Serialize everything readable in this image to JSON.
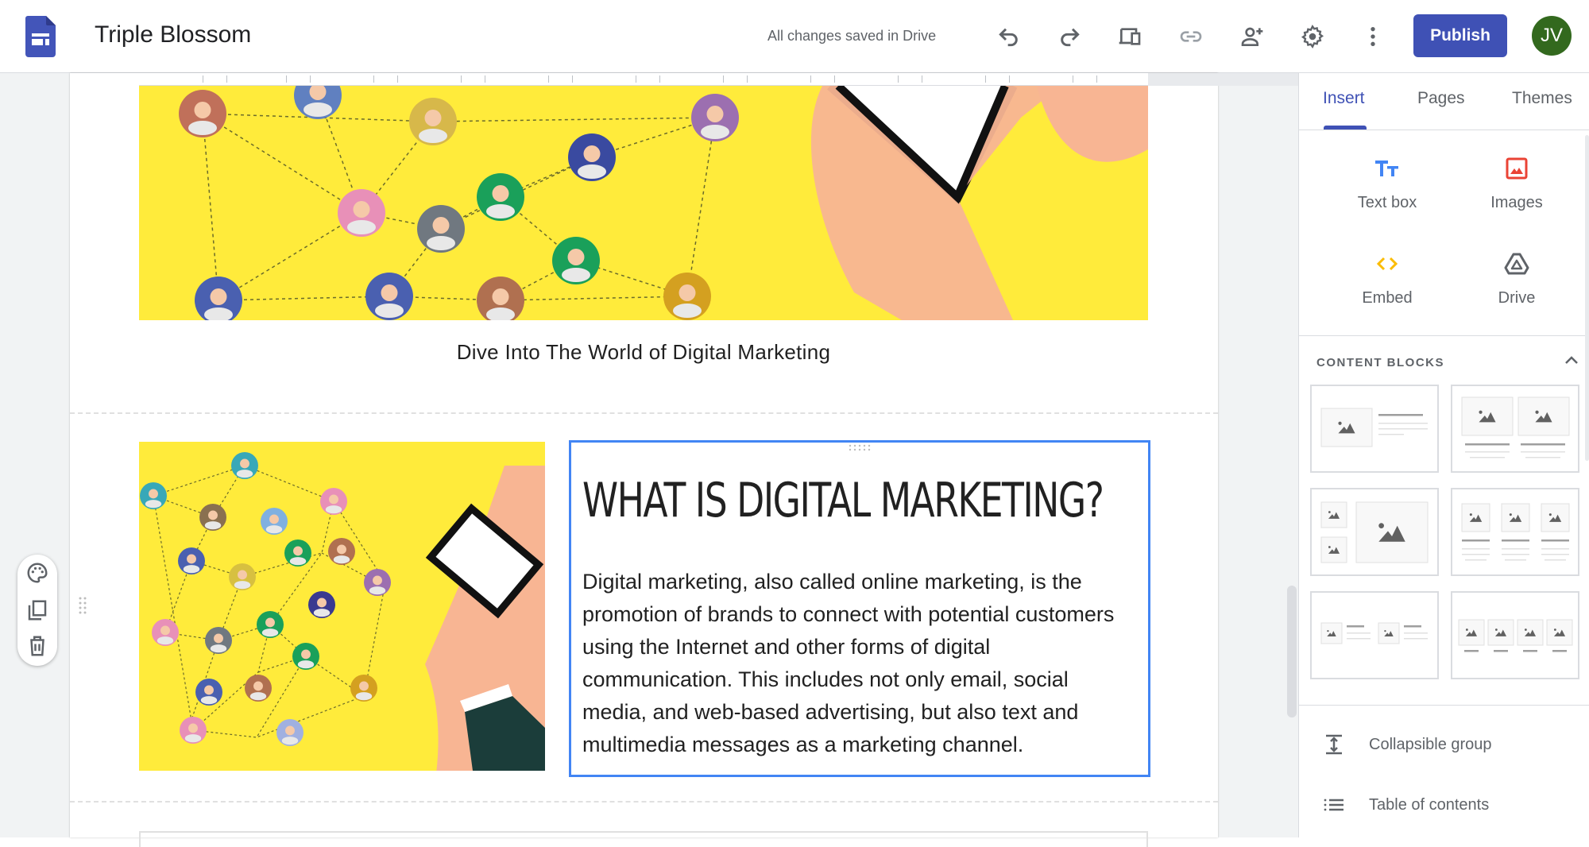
{
  "header": {
    "app_icon": "google-sites-icon",
    "title": "Triple Blossom",
    "save_status": "All changes saved in Drive",
    "toolbar_icons": [
      "undo-icon",
      "redo-icon",
      "preview-devices-icon",
      "copy-link-icon",
      "share-add-person-icon",
      "settings-gear-icon",
      "more-vert-icon"
    ],
    "publish_label": "Publish",
    "avatar_initials": "JV"
  },
  "canvas": {
    "banner_caption": "Dive Into The World of Digital Marketing",
    "section": {
      "heading": "WHAT IS DIGITAL MARKETING?",
      "body": "Digital marketing, also called online marketing, is the promotion of brands to connect with potential customers using the Internet and other forms of digital communication. This includes not only email, social media, and web-based advertising, but also text and multimedia messages as a marketing channel."
    },
    "section_tools": [
      "palette-icon",
      "duplicate-icon",
      "delete-icon"
    ]
  },
  "panel": {
    "tabs": [
      {
        "label": "Insert",
        "active": true
      },
      {
        "label": "Pages",
        "active": false
      },
      {
        "label": "Themes",
        "active": false
      }
    ],
    "insert_items": [
      {
        "label": "Text box",
        "icon": "text-box-icon",
        "color": "#4285f4"
      },
      {
        "label": "Images",
        "icon": "image-icon",
        "color": "#ea4335"
      },
      {
        "label": "Embed",
        "icon": "embed-code-icon",
        "color": "#fbbc04"
      },
      {
        "label": "Drive",
        "icon": "drive-icon",
        "color": "#5f6368"
      }
    ],
    "content_blocks_title": "CONTENT BLOCKS",
    "content_blocks": [
      "image-left-text-right",
      "two-images-with-text",
      "image-collage",
      "three-images-with-text",
      "two-images-side-text",
      "four-images-captions"
    ],
    "list_items": [
      {
        "label": "Collapsible group",
        "icon": "collapsible-group-icon"
      },
      {
        "label": "Table of contents",
        "icon": "table-of-contents-icon"
      }
    ]
  },
  "colors": {
    "accent": "#3f51b5",
    "selection": "#4285f4",
    "avatar_bg": "#33691e",
    "banner_yellow": "#ffeb3b"
  }
}
